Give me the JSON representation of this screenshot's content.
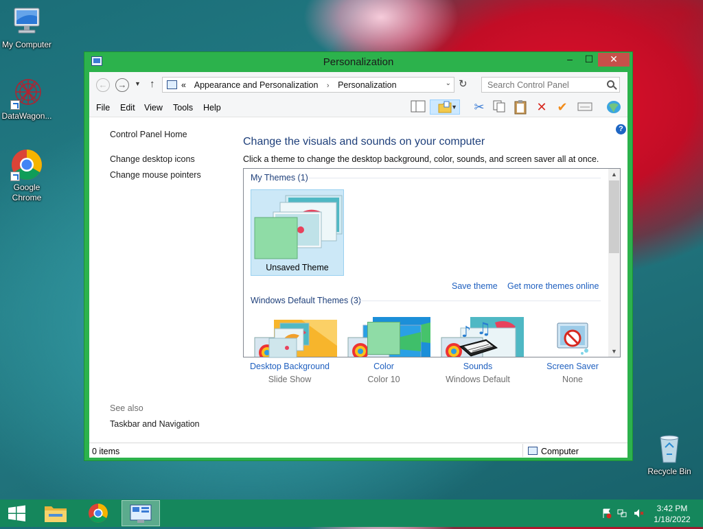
{
  "desktop": {
    "icons": [
      {
        "label": "My Computer"
      },
      {
        "label": "DataWagon..."
      },
      {
        "label": "Google Chrome"
      },
      {
        "label": "Recycle Bin"
      }
    ]
  },
  "window": {
    "title": "Personalization",
    "controls": {
      "minimize": "–",
      "maximize": "☐",
      "close": "✕"
    },
    "address": {
      "overflow": "«",
      "crumbs": [
        "Appearance and Personalization",
        "Personalization"
      ],
      "separator": "›"
    },
    "search": {
      "placeholder": "Search Control Panel"
    },
    "menu": [
      "File",
      "Edit",
      "View",
      "Tools",
      "Help"
    ],
    "sidebar": {
      "home": "Control Panel Home",
      "links": [
        "Change desktop icons",
        "Change mouse pointers"
      ],
      "see_also": "See also",
      "see_also_links": [
        "Taskbar and Navigation"
      ]
    },
    "main": {
      "heading": "Change the visuals and sounds on your computer",
      "description": "Click a theme to change the desktop background, color, sounds, and screen saver all at once.",
      "my_themes_header": "My Themes (1)",
      "unsaved_theme": "Unsaved Theme",
      "save_theme": "Save theme",
      "get_more": "Get more themes online",
      "default_header": "Windows Default Themes (3)"
    },
    "bottom": [
      {
        "label": "Desktop Background",
        "value": "Slide Show"
      },
      {
        "label": "Color",
        "value": "Color 10"
      },
      {
        "label": "Sounds",
        "value": "Windows Default"
      },
      {
        "label": "Screen Saver",
        "value": "None"
      }
    ],
    "status": {
      "items": "0 items",
      "location": "Computer"
    }
  },
  "taskbar": {
    "time": "3:42 PM",
    "date": "1/18/2022"
  },
  "colors": {
    "window_frame": "#2cb24c",
    "taskbar": "#15875c",
    "link": "#1e5fbf",
    "heading": "#1e3f7a",
    "theme_color": "#8fdca6"
  }
}
